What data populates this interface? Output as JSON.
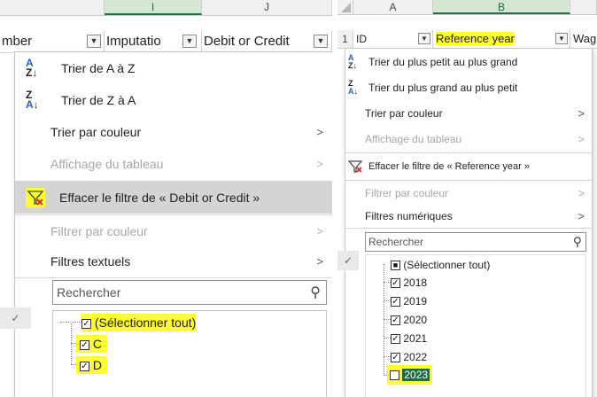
{
  "left": {
    "column_letters": [
      "I",
      "J"
    ],
    "header_cells": [
      "mber",
      "Imputatio",
      "Debit or Credit"
    ],
    "menu": {
      "items": [
        {
          "label": "Trier de A à Z",
          "icon": "sort-az-icon",
          "disabled": false
        },
        {
          "label": "Trier de Z à A",
          "icon": "sort-za-icon",
          "disabled": false
        },
        {
          "label": "Trier par couleur",
          "disabled": false
        },
        {
          "label": "Affichage du tableau",
          "disabled": true
        },
        {
          "label": "Effacer le filtre de « Debit or Credit »",
          "icon": "clear-filter-icon",
          "disabled": false
        },
        {
          "label": "Filtrer par couleur",
          "disabled": true
        },
        {
          "label": "Filtres textuels",
          "disabled": false
        }
      ],
      "search_placeholder": "Rechercher",
      "tree": [
        {
          "label": "(Sélectionner tout)",
          "checked": true
        },
        {
          "label": "C",
          "checked": true
        },
        {
          "label": "D",
          "checked": true
        }
      ]
    }
  },
  "right": {
    "column_letters": [
      "A",
      "B"
    ],
    "row_number": "1",
    "header_cells": [
      "ID",
      "Reference year",
      "Wag"
    ],
    "menu": {
      "items": [
        {
          "label": "Trier du plus petit au plus grand",
          "icon": "sort-az-icon",
          "disabled": false
        },
        {
          "label": "Trier du plus grand au plus petit",
          "icon": "sort-za-icon",
          "disabled": false
        },
        {
          "label": "Trier par couleur",
          "disabled": false
        },
        {
          "label": "Affichage du tableau",
          "disabled": true
        },
        {
          "label": "Effacer le filtre de « Reference year »",
          "icon": "clear-filter-icon",
          "disabled": false
        },
        {
          "label": "Filtrer par couleur",
          "disabled": true
        },
        {
          "label": "Filtres numériques",
          "disabled": false
        }
      ],
      "search_placeholder": "Rechercher",
      "tree": [
        {
          "label": "(Sélectionner tout)",
          "checked": "partial"
        },
        {
          "label": "2018",
          "checked": true
        },
        {
          "label": "2019",
          "checked": true
        },
        {
          "label": "2020",
          "checked": true
        },
        {
          "label": "2021",
          "checked": true
        },
        {
          "label": "2022",
          "checked": true
        },
        {
          "label": "2023",
          "checked": false
        }
      ]
    }
  },
  "colors": {
    "highlight": "#ffff33",
    "excel_green": "#217346",
    "hover": "#d4d4d4"
  }
}
